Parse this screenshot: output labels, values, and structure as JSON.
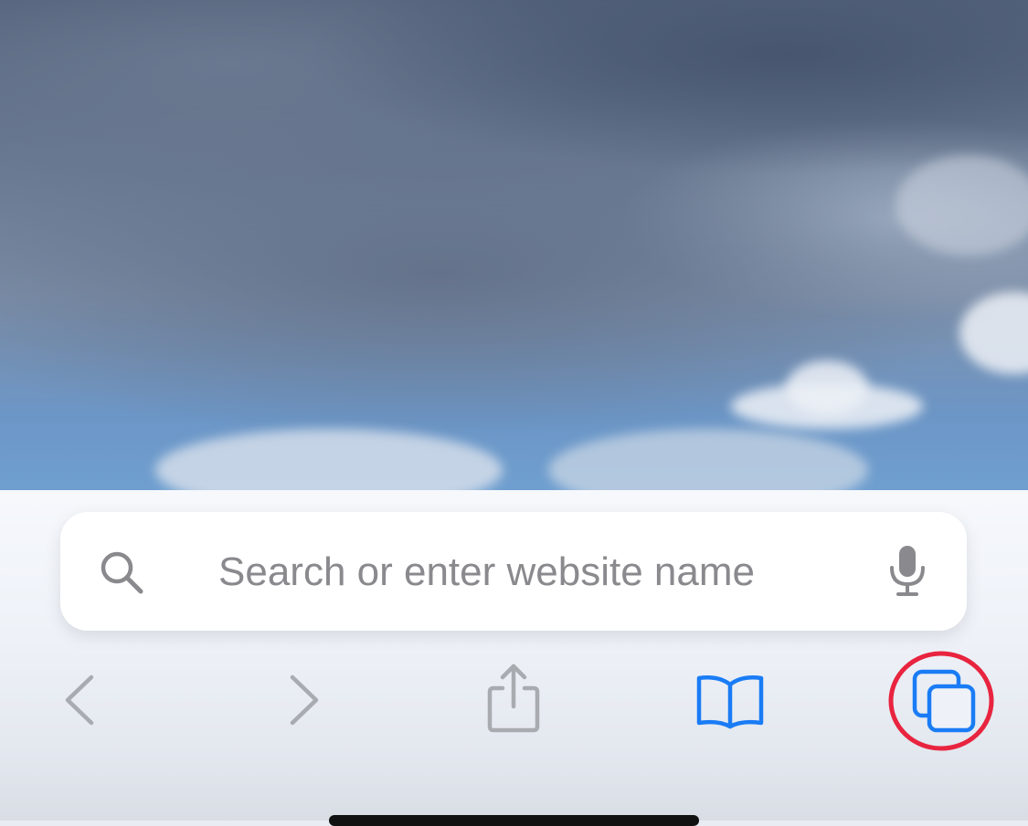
{
  "search": {
    "placeholder": "Search or enter website name"
  },
  "toolbar": {
    "buttons": [
      "back-icon",
      "forward-icon",
      "share-icon",
      "bookmarks-icon",
      "tabs-icon"
    ]
  },
  "colors": {
    "accent": "#1a7cf5",
    "disabled": "#a8abb0",
    "highlight_ring": "#e8243f"
  }
}
